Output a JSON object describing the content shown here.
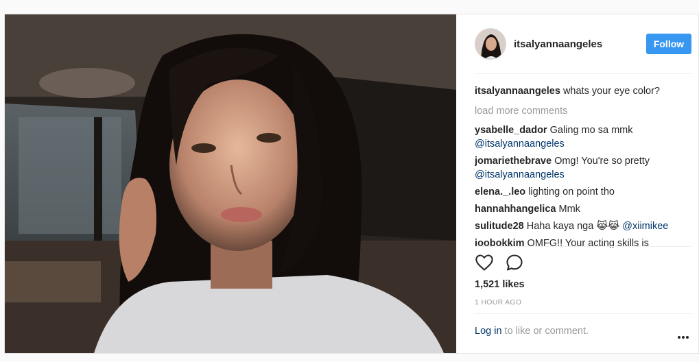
{
  "post": {
    "username": "itsalyannaangeles",
    "follow_label": "Follow",
    "caption_user": "itsalyannaangeles",
    "caption_text": "whats your eye color?",
    "load_more": "load more comments",
    "comments": [
      {
        "user": "ysabelle_dador",
        "text": "Galing mo sa mmk",
        "mention": "@itsalyannaangeles"
      },
      {
        "user": "jomariethebrave",
        "text": "Omg! You're so pretty",
        "mention": "@itsalyannaangeles"
      },
      {
        "user": "elena._.leo",
        "text": "lighting on point tho",
        "mention": ""
      },
      {
        "user": "hannahhangelica",
        "text": "Mmk",
        "mention": ""
      },
      {
        "user": "sulitude28",
        "text": "Haha kaya nga 😹😹",
        "mention": "@xiimikee"
      },
      {
        "user": "ioobokkim",
        "text": "OMFG!! Your acting skills is",
        "mention": ""
      }
    ],
    "likes": "1,521 likes",
    "time": "1 HOUR AGO",
    "footer_login": "Log in",
    "footer_rest": "to like or comment.",
    "icons": {
      "like": "heart-icon",
      "comment": "comment-bubble-icon",
      "more": "more-options-icon"
    },
    "colors": {
      "follow_button": "#3897f0",
      "link": "#003569",
      "muted": "#999999"
    }
  }
}
